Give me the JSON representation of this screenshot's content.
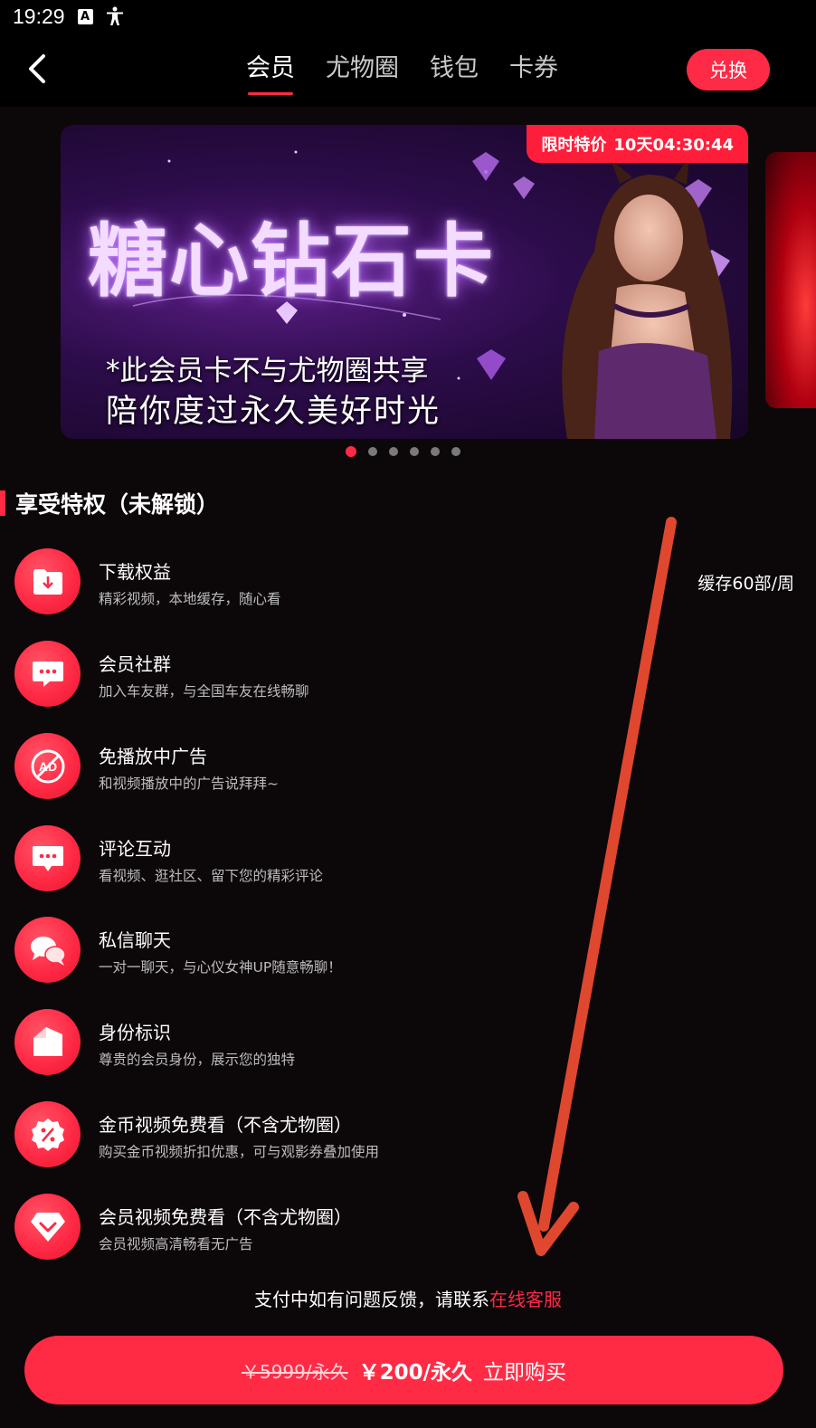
{
  "status": {
    "time": "19:29",
    "a_icon": "A"
  },
  "nav": {
    "tabs": [
      {
        "label": "会员",
        "active": true
      },
      {
        "label": "尤物圈",
        "active": false
      },
      {
        "label": "钱包",
        "active": false
      },
      {
        "label": "卡券",
        "active": false
      }
    ],
    "redeem_label": "兑换"
  },
  "banner": {
    "title": "糖心钻石卡",
    "line1": "*此会员卡不与尤物圈共享",
    "line2": "陪你度过永久美好时光",
    "promo_label": "限时特价",
    "countdown": "10天04:30:44",
    "page_count": 6,
    "current_page": 1
  },
  "section": {
    "title": "享受特权（未解锁）"
  },
  "perks": [
    {
      "title": "下载权益",
      "desc": "精彩视频，本地缓存，随心看",
      "extra": "缓存60部/周",
      "icon": "download-folder-icon"
    },
    {
      "title": "会员社群",
      "desc": "加入车友群，与全国车友在线畅聊",
      "extra": "",
      "icon": "chat-bubble-icon"
    },
    {
      "title": "免播放中广告",
      "desc": "和视频播放中的广告说拜拜~",
      "extra": "",
      "icon": "no-ad-icon"
    },
    {
      "title": "评论互动",
      "desc": "看视频、逛社区、留下您的精彩评论",
      "extra": "",
      "icon": "comment-bubble-icon"
    },
    {
      "title": "私信聊天",
      "desc": "一对一聊天，与心仪女神UP随意畅聊！",
      "extra": "",
      "icon": "private-chat-icon"
    },
    {
      "title": "身份标识",
      "desc": "尊贵的会员身份，展示您的独特",
      "extra": "",
      "icon": "badge-tag-icon"
    },
    {
      "title": "金币视频免费看（不含尤物圈）",
      "desc": "购买金币视频折扣优惠，可与观影券叠加使用",
      "extra": "",
      "icon": "discount-icon"
    },
    {
      "title": "会员视频免费看（不含尤物圈）",
      "desc": "会员视频高清畅看无广告",
      "extra": "",
      "icon": "diamond-icon"
    }
  ],
  "support": {
    "prefix": "支付中如有问题反馈，请联系",
    "link": "在线客服"
  },
  "buy": {
    "old_price": "￥5999/永久",
    "new_price": "￥200/永久",
    "action": "立即购买"
  },
  "colors": {
    "accent": "#ff2a45",
    "background": "#0c0709",
    "annotation_arrow": "#e0472f"
  }
}
